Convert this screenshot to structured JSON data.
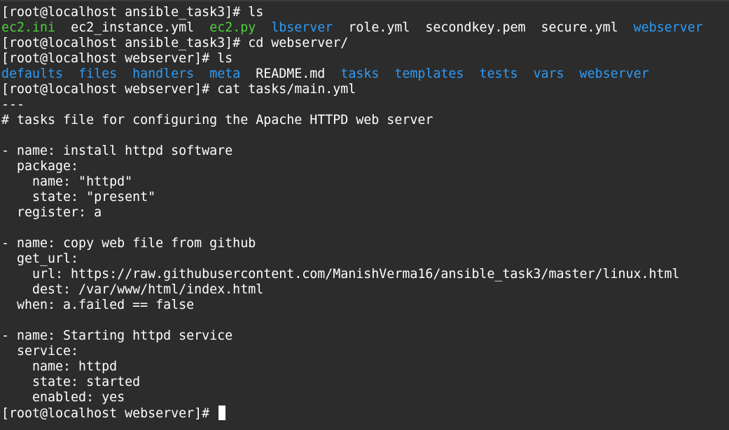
{
  "terminal": {
    "prompt1": "[root@localhost ansible_task3]# ls",
    "ls1": [
      {
        "name": "ec2.ini",
        "color": "green"
      },
      {
        "name": "ec2_instance.yml",
        "color": "white"
      },
      {
        "name": "ec2.py",
        "color": "green"
      },
      {
        "name": "lbserver",
        "color": "blue"
      },
      {
        "name": "role.yml",
        "color": "white"
      },
      {
        "name": "secondkey.pem",
        "color": "white"
      },
      {
        "name": "secure.yml",
        "color": "white"
      },
      {
        "name": "webserver",
        "color": "blue"
      }
    ],
    "prompt2": "[root@localhost ansible_task3]# cd webserver/",
    "prompt3": "[root@localhost webserver]# ls",
    "ls2": [
      {
        "name": "defaults",
        "color": "blue"
      },
      {
        "name": "files",
        "color": "blue"
      },
      {
        "name": "handlers",
        "color": "blue"
      },
      {
        "name": "meta",
        "color": "blue"
      },
      {
        "name": "README.md",
        "color": "white"
      },
      {
        "name": "tasks",
        "color": "blue"
      },
      {
        "name": "templates",
        "color": "blue"
      },
      {
        "name": "tests",
        "color": "blue"
      },
      {
        "name": "vars",
        "color": "blue"
      },
      {
        "name": "webserver",
        "color": "blue"
      }
    ],
    "prompt4": "[root@localhost webserver]# cat tasks/main.yml",
    "file_lines": [
      "---",
      "# tasks file for configuring the Apache HTTPD web server",
      "",
      "- name: install httpd software",
      "  package:",
      "    name: \"httpd\"",
      "    state: \"present\"",
      "  register: a",
      "",
      "- name: copy web file from github",
      "  get_url:",
      "    url: https://raw.githubusercontent.com/ManishVerma16/ansible_task3/master/linux.html",
      "    dest: /var/www/html/index.html",
      "  when: a.failed == false",
      "",
      "- name: Starting httpd service",
      "  service:",
      "    name: httpd",
      "    state: started",
      "    enabled: yes"
    ],
    "final_prompt": "[root@localhost webserver]# "
  },
  "colors": {
    "background": "#2c2c2c",
    "green": "#4fd03b",
    "blue": "#2f9bf4",
    "text": "#ffffff"
  }
}
